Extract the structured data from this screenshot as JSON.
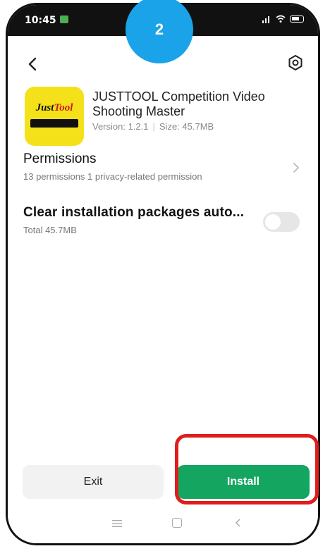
{
  "status_bar": {
    "time": "10:45"
  },
  "badge": {
    "step": "2",
    "color": "#1aa3e8"
  },
  "app": {
    "logo_top": "Just",
    "logo_top_accent": "Tool",
    "title": "JUSTTOOL Competition Video Shooting Master",
    "version": "Version: 1.2.1",
    "size": "Size: 45.7MB"
  },
  "permissions": {
    "title": "Permissions",
    "subtitle": "13 permissions 1 privacy-related permission"
  },
  "clear_packages": {
    "title": "Clear installation packages auto...",
    "subtitle": "Total 45.7MB"
  },
  "buttons": {
    "exit_label": "Exit",
    "install_label": "Install",
    "install_color": "#14a660",
    "highlight_color": "#e01c1c"
  },
  "icons": {
    "back": "back-arrow-icon",
    "settings": "settings-icon",
    "chevron": "chevron-right-icon",
    "nav_menu": "menu-icon",
    "nav_home": "home-icon",
    "nav_back": "back-icon"
  }
}
